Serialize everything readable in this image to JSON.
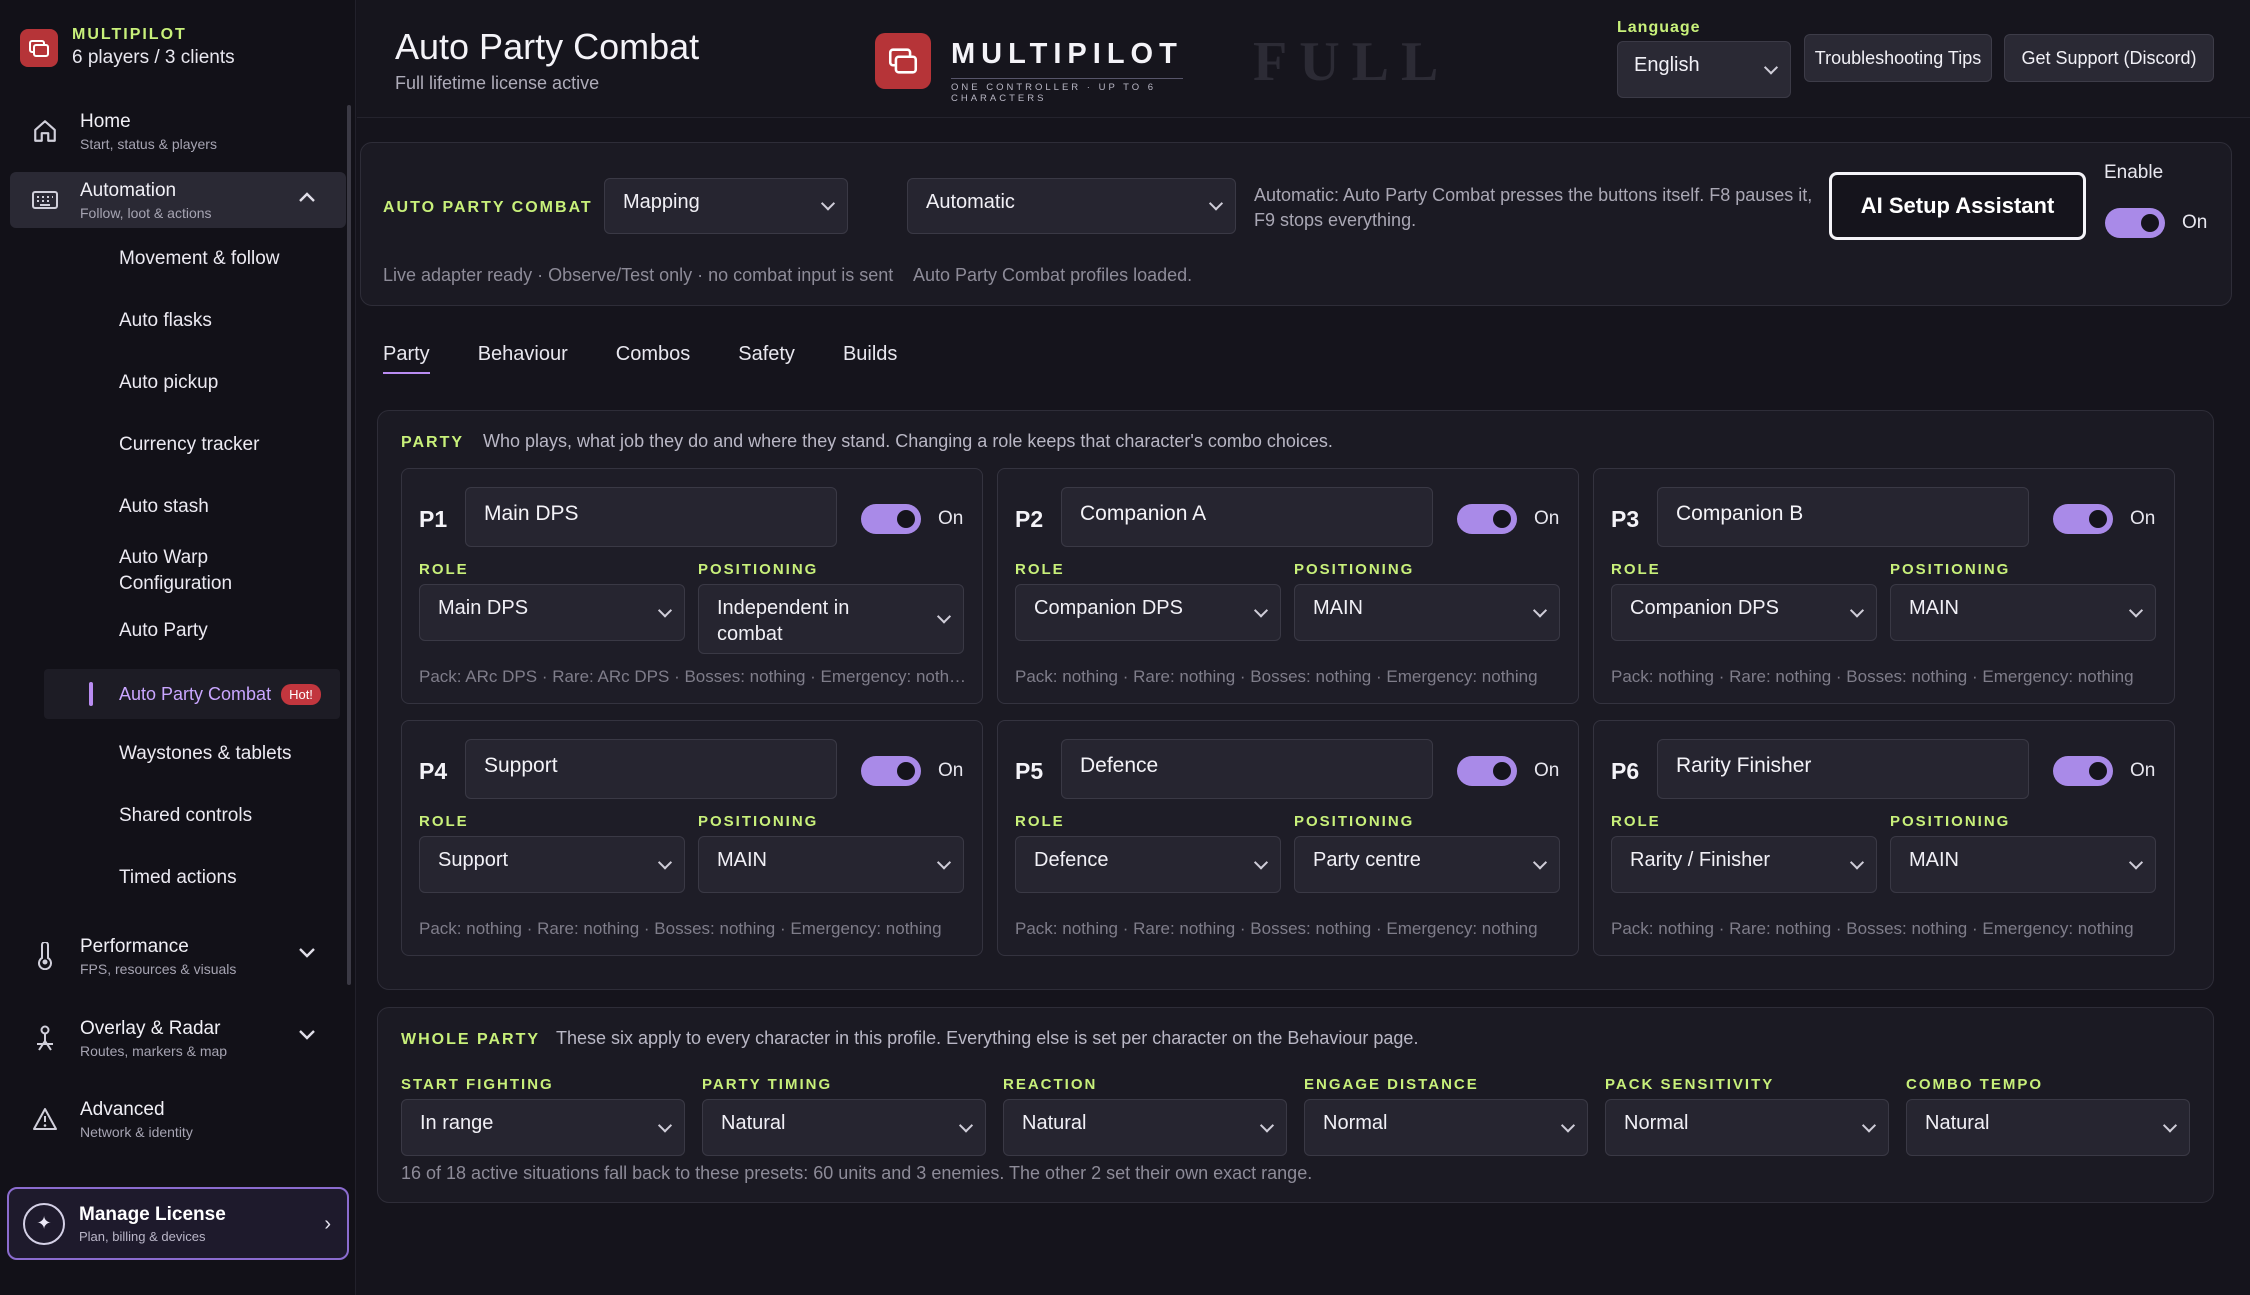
{
  "brand": {
    "name": "MULTIPILOT",
    "sub": "6 players / 3 clients"
  },
  "nav": {
    "home": {
      "title": "Home",
      "sub": "Start, status & players"
    },
    "automation": {
      "title": "Automation",
      "sub": "Follow, loot & actions"
    },
    "sub_items": [
      "Movement & follow",
      "Auto flasks",
      "Auto pickup",
      "Currency tracker",
      "Auto stash",
      "Auto Warp Configuration",
      "Auto Party"
    ],
    "active_sub": {
      "label": "Auto Party Combat",
      "badge": "Hot!"
    },
    "sub_items_after": [
      "Waystones & tablets",
      "Shared controls",
      "Timed actions"
    ],
    "performance": {
      "title": "Performance",
      "sub": "FPS, resources & visuals"
    },
    "overlay": {
      "title": "Overlay & Radar",
      "sub": "Routes, markers & map"
    },
    "advanced": {
      "title": "Advanced",
      "sub": "Network & identity"
    },
    "license": {
      "title": "Manage License",
      "sub": "Plan, billing & devices"
    }
  },
  "header": {
    "title": "Auto Party Combat",
    "subtitle": "Full lifetime license active",
    "logo_word": "MULTIPILOT",
    "logo_tag": "ONE CONTROLLER · UP TO 6 CHARACTERS",
    "edition": "FULL",
    "language_label": "Language",
    "language_value": "English",
    "troubleshoot": "Troubleshooting Tips",
    "support": "Get Support (Discord)"
  },
  "apc": {
    "label": "AUTO PARTY COMBAT",
    "mode": "Mapping",
    "control": "Automatic",
    "desc1": "Automatic: Auto Party Combat presses the buttons itself. F8 pauses it,",
    "desc2": "F9 stops everything.",
    "ai_button": "AI Setup Assistant",
    "enable_label": "Enable",
    "enable_state": "On",
    "status1": "Live adapter ready · Observe/Test only · no combat input is sent",
    "status2": "Auto Party Combat profiles loaded."
  },
  "tabs": [
    "Party",
    "Behaviour",
    "Combos",
    "Safety",
    "Builds"
  ],
  "party": {
    "label": "PARTY",
    "desc": "Who plays, what job they do and where they stand. Changing a role keeps that character's combo choices.",
    "role_label": "ROLE",
    "pos_label": "POSITIONING",
    "on": "On",
    "players": [
      {
        "id": "P1",
        "name": "Main DPS",
        "role": "Main DPS",
        "pos": "Independent in combat",
        "foot": "Pack: ARc DPS  ·  Rare: ARc DPS  ·  Bosses: nothing  ·  Emergency: nothing"
      },
      {
        "id": "P2",
        "name": "Companion A",
        "role": "Companion DPS",
        "pos": "MAIN",
        "foot": "Pack: nothing  ·  Rare: nothing  ·  Bosses: nothing  ·  Emergency: nothing"
      },
      {
        "id": "P3",
        "name": "Companion B",
        "role": "Companion DPS",
        "pos": "MAIN",
        "foot": "Pack: nothing  ·  Rare: nothing  ·  Bosses: nothing  ·  Emergency: nothing"
      },
      {
        "id": "P4",
        "name": "Support",
        "role": "Support",
        "pos": "MAIN",
        "foot": "Pack: nothing  ·  Rare: nothing  ·  Bosses: nothing  ·  Emergency: nothing"
      },
      {
        "id": "P5",
        "name": "Defence",
        "role": "Defence",
        "pos": "Party centre",
        "foot": "Pack: nothing  ·  Rare: nothing  ·  Bosses: nothing  ·  Emergency: nothing"
      },
      {
        "id": "P6",
        "name": "Rarity Finisher",
        "role": "Rarity / Finisher",
        "pos": "MAIN",
        "foot": "Pack: nothing  ·  Rare: nothing  ·  Bosses: nothing  ·  Emergency: nothing"
      }
    ]
  },
  "whole": {
    "label": "WHOLE PARTY",
    "desc": "These six apply to every character in this profile. Everything else is set per character on the Behaviour page.",
    "items": [
      {
        "label": "START FIGHTING",
        "value": "In range"
      },
      {
        "label": "PARTY TIMING",
        "value": "Natural"
      },
      {
        "label": "REACTION",
        "value": "Natural"
      },
      {
        "label": "ENGAGE DISTANCE",
        "value": "Normal"
      },
      {
        "label": "PACK SENSITIVITY",
        "value": "Normal"
      },
      {
        "label": "COMBO TEMPO",
        "value": "Natural"
      }
    ],
    "note": "16 of 18 active situations fall back to these presets: 60 units and 3 enemies. The other 2 set their own exact range."
  }
}
